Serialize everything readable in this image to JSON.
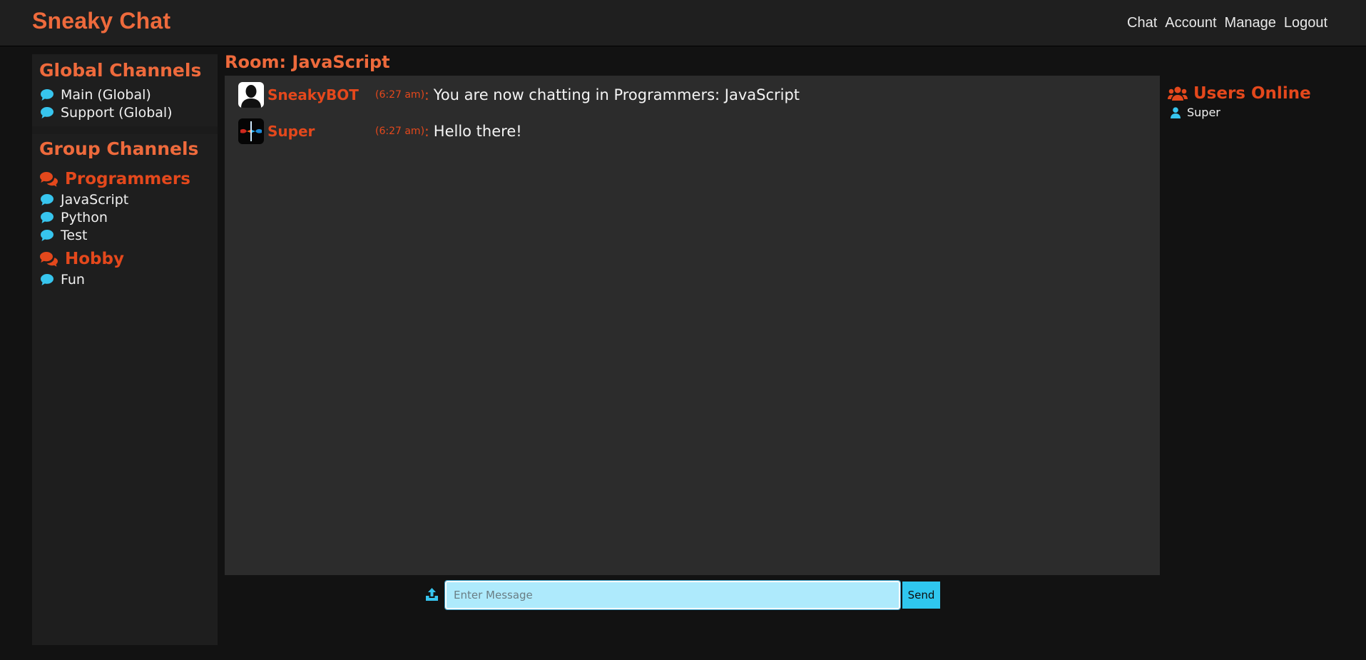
{
  "app": {
    "brand": "Sneaky Chat"
  },
  "nav": {
    "items": [
      "Chat",
      "Account",
      "Manage",
      "Logout"
    ]
  },
  "sidebar": {
    "global_title": "Global Channels",
    "global_channels": [
      "Main (Global)",
      "Support (Global)"
    ],
    "group_title": "Group Channels",
    "groups": [
      {
        "name": "Programmers",
        "channels": [
          "JavaScript",
          "Python",
          "Test"
        ]
      },
      {
        "name": "Hobby",
        "channels": [
          "Fun"
        ]
      }
    ]
  },
  "room": {
    "title": "Room: JavaScript",
    "messages": [
      {
        "user": "SneakyBOT",
        "time": "(6:27 am)",
        "colon": ":",
        "text": "You are now chatting in Programmers: JavaScript"
      },
      {
        "user": "Super",
        "time": "(6:27 am)",
        "colon": ":",
        "text": "Hello there!"
      }
    ]
  },
  "composer": {
    "placeholder": "Enter Message",
    "send_label": "Send"
  },
  "users_online": {
    "title": "Users Online",
    "users": [
      "Super"
    ]
  },
  "colors": {
    "brand": "#ee6a3c",
    "accent_red": "#e4481c",
    "accent_cyan": "#2fc7ef",
    "input_bg": "#aeeafc"
  },
  "icons": {
    "channel": "comment-icon",
    "group": "comments-icon",
    "upload": "upload-icon",
    "users": "users-icon",
    "user": "user-icon"
  }
}
